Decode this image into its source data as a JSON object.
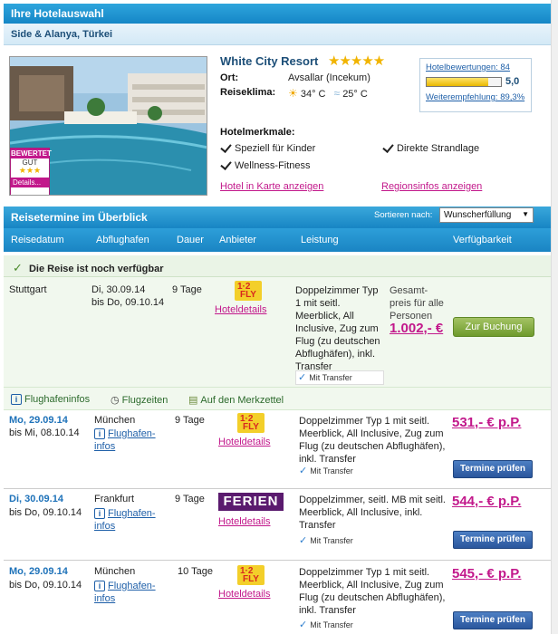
{
  "header": {
    "title": "Ihre Hotelauswahl",
    "region": "Side & Alanya, Türkei"
  },
  "hotel": {
    "name": "White City Resort",
    "stars": "★★★★★",
    "ort_label": "Ort:",
    "ort_value": "Avsallar (Incekum)",
    "klima_label": "Reiseklima:",
    "temp_sun": "34° C",
    "temp_water": "25° C",
    "badge_title": "BEWERTET",
    "badge_sub": "GUT",
    "badge_stars": "★★★",
    "badge_link": "Details..."
  },
  "rating": {
    "reviews_link": "Hotelbewertungen: 84",
    "score": "5,0",
    "score_fraction": 0.83,
    "recommend_link": "Weiterempfehlung: 89,3%"
  },
  "features": {
    "title": "Hotelmerkmale:",
    "items": [
      "Speziell für Kinder",
      "Direkte Strandlage",
      "Wellness-Fitness"
    ],
    "map_link": "Hotel in Karte anzeigen",
    "region_link": "Regionsinfos anzeigen"
  },
  "overview": {
    "title": "Reisetermine im Überblick",
    "sort_label": "Sortieren nach:",
    "sort_value": "Wunscherfüllung",
    "columns": [
      "Reisedatum",
      "Abflughafen",
      "Dauer",
      "Anbieter",
      "Leistung",
      "Verfügbarkeit"
    ]
  },
  "availability": {
    "text": "Die Reise ist noch verfügbar"
  },
  "selected": {
    "airport": "Stuttgart",
    "date_from": "Di, 30.09.14",
    "date_to": "bis Do, 09.10.14",
    "duration": "9 Tage",
    "provider_logo": "1-2-FLY",
    "details_link": "Hoteldetails",
    "service": "Doppelzimmer Typ 1 mit seitl. Meerblick, All Inclusive, Zug zum Flug (zu deutschen Abflughäfen), inkl. Transfer",
    "transfer": "Mit Transfer",
    "price_label": "Gesamt-preis für alle Personen",
    "price": "1.002,- €",
    "book_button": "Zur Buchung"
  },
  "actions": {
    "airport_info": "Flughafeninfos",
    "flight_times": "Flugzeiten",
    "memo": "Auf den Merkzettel"
  },
  "offers": [
    {
      "date_from": "Mo, 29.09.14",
      "date_to": "bis Mi, 08.10.14",
      "airport": "München",
      "airport_link": "Flughafen-infos",
      "duration": "9 Tage",
      "provider_logo": "1-2-FLY",
      "details_link": "Hoteldetails",
      "service": "Doppelzimmer Typ 1 mit seitl. Meerblick, All Inclusive, Zug zum Flug (zu deutschen Abflughäfen), inkl. Transfer",
      "transfer": "Mit Transfer",
      "price": "531,- € p.P.",
      "button": "Termine prüfen"
    },
    {
      "date_from": "Di, 30.09.14",
      "date_to": "bis Do, 09.10.14",
      "airport": "Frankfurt",
      "airport_link": "Flughafen-infos",
      "duration": "9 Tage",
      "provider_logo": "FERIEN",
      "details_link": "Hoteldetails",
      "service": "Doppelzimmer, seitl. MB mit seitl. Meerblick, All Inclusive, inkl. Transfer",
      "transfer": "Mit Transfer",
      "price": "544,- € p.P.",
      "button": "Termine prüfen"
    },
    {
      "date_from": "Mo, 29.09.14",
      "date_to": "bis Do, 09.10.14",
      "airport": "München",
      "airport_link": "Flughafen-infos",
      "duration": "10 Tage",
      "provider_logo": "1-2-FLY",
      "details_link": "Hoteldetails",
      "service": "Doppelzimmer Typ 1 mit seitl. Meerblick, All Inclusive, Zug zum Flug (zu deutschen Abflughäfen), inkl. Transfer",
      "transfer": "Mit Transfer",
      "price": "545,- € p.P.",
      "button": "Termine prüfen"
    }
  ]
}
